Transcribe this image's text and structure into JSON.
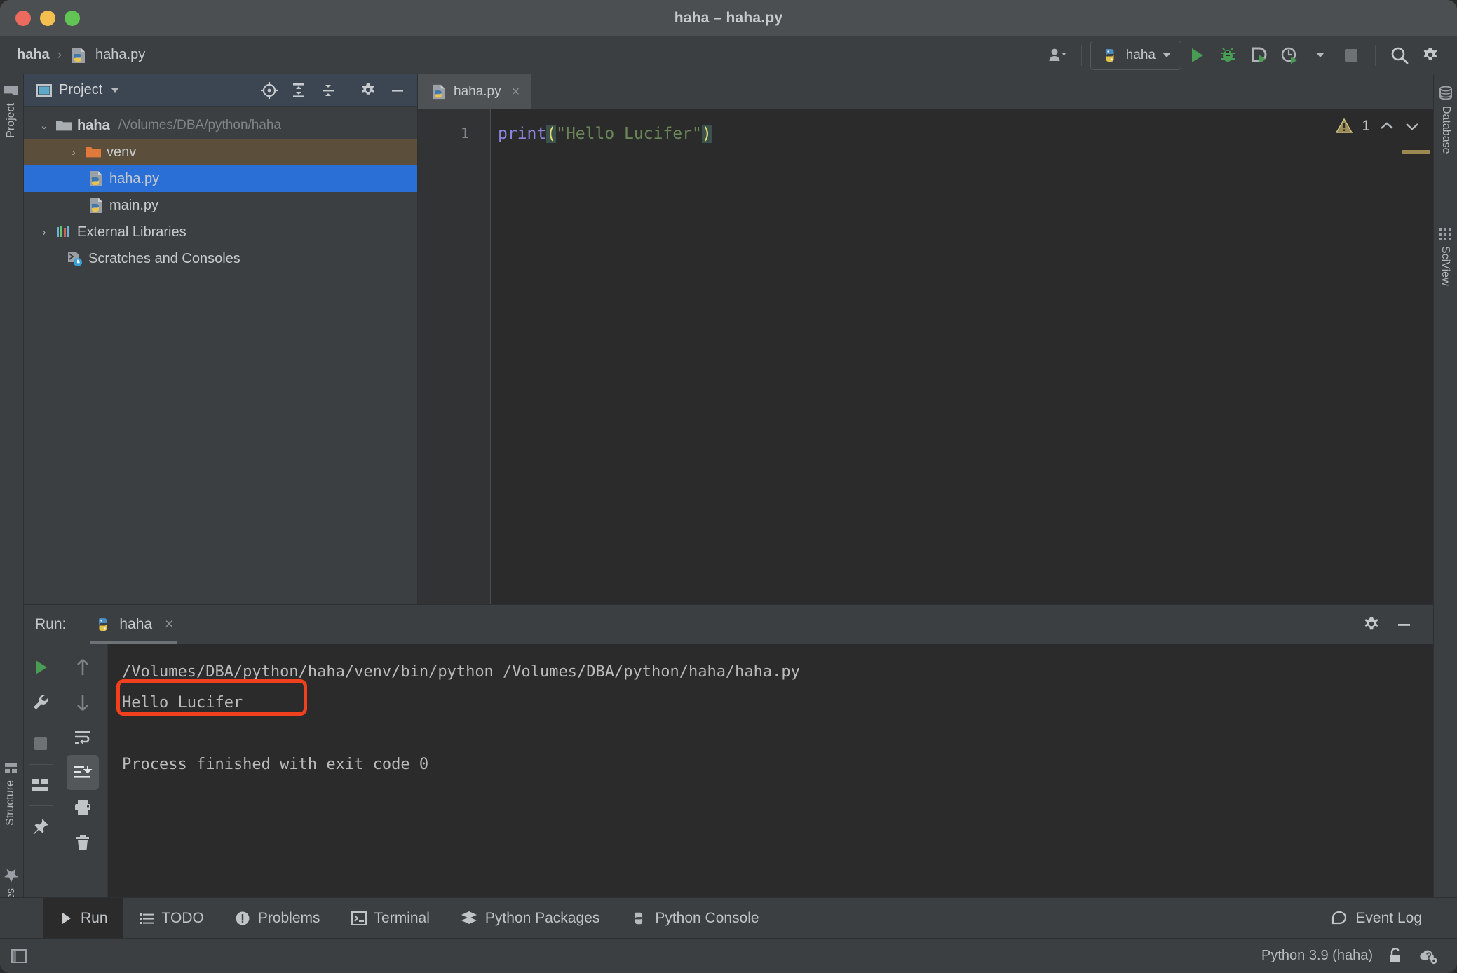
{
  "window": {
    "title": "haha – haha.py",
    "traffic_lights": [
      "close-red",
      "minimize-yellow",
      "zoom-green"
    ]
  },
  "toolbar": {
    "breadcrumb": {
      "project": "haha",
      "separator": "›",
      "file": "haha.py"
    },
    "icons": {
      "account": "account-icon",
      "run": "run-icon",
      "debug": "debug-icon",
      "coverage": "coverage-icon",
      "profile": "profile-icon",
      "stop": "stop-icon",
      "search": "search-icon",
      "settings": "settings-gear-icon"
    },
    "run_config": {
      "label": "haha",
      "icon": "python-icon"
    }
  },
  "rails": {
    "left": [
      {
        "label": "Project",
        "icon": "folder-icon"
      },
      {
        "label": "Structure",
        "icon": "structure-icon"
      },
      {
        "label": "Favorites",
        "icon": "star-icon"
      }
    ],
    "right": [
      {
        "label": "Database",
        "icon": "database-icon"
      },
      {
        "label": "SciView",
        "icon": "grid-icon"
      }
    ]
  },
  "project_panel": {
    "title": "Project",
    "tools": [
      "locate-icon",
      "expand-all-icon",
      "collapse-all-icon",
      "settings-gear-icon",
      "hide-icon"
    ],
    "tree": [
      {
        "label": "haha",
        "path": "/Volumes/DBA/python/haha",
        "icon": "folder-icon",
        "arrow": "⌄",
        "state": "expanded",
        "indent": 1,
        "bold": true
      },
      {
        "label": "venv",
        "path": "",
        "icon": "folder-orange-icon",
        "arrow": "›",
        "state": "hover",
        "indent": 2,
        "bold": false
      },
      {
        "label": "haha.py",
        "path": "",
        "icon": "python-file-icon",
        "arrow": "",
        "state": "selected",
        "indent": 3,
        "bold": false
      },
      {
        "label": "main.py",
        "path": "",
        "icon": "python-file-icon",
        "arrow": "",
        "state": "",
        "indent": 3,
        "bold": false
      },
      {
        "label": "External Libraries",
        "path": "",
        "icon": "libraries-icon",
        "arrow": "›",
        "state": "",
        "indent": 1,
        "bold": false
      },
      {
        "label": "Scratches and Consoles",
        "path": "",
        "icon": "scratches-icon",
        "arrow": "",
        "state": "",
        "indent": 2,
        "bold": false
      }
    ]
  },
  "editor": {
    "tab": {
      "label": "haha.py",
      "icon": "python-file-icon",
      "close": "×"
    },
    "line_number": "1",
    "code": {
      "func": "print",
      "open_paren": "(",
      "string": "\"Hello Lucifer\"",
      "close_paren": ")"
    },
    "inspections": {
      "count": "1",
      "icon": "warning-triangle-icon",
      "prev": "⌃",
      "next": "⌄"
    }
  },
  "run_panel": {
    "label": "Run:",
    "tab": {
      "label": "haha",
      "icon": "python-icon",
      "close": "×"
    },
    "header_tools": [
      "settings-gear-icon",
      "hide-icon"
    ],
    "left_tools": [
      "rerun-icon",
      "wrench-icon",
      "stop-icon",
      "layout-icon",
      "pin-icon"
    ],
    "right_tools": [
      "up-arrow-icon",
      "down-arrow-icon",
      "soft-wrap-icon",
      "scroll-to-end-icon",
      "print-icon",
      "trash-icon"
    ],
    "console_lines": [
      "/Volumes/DBA/python/haha/venv/bin/python /Volumes/DBA/python/haha/haha.py",
      "Hello Lucifer",
      "",
      "Process finished with exit code 0"
    ],
    "highlight": {
      "text": "Hello Lucifer",
      "color": "#f0401e"
    }
  },
  "bottom_bar": {
    "items": [
      {
        "label": "Run",
        "icon": "run-icon",
        "active": true
      },
      {
        "label": "TODO",
        "icon": "todo-icon",
        "active": false
      },
      {
        "label": "Problems",
        "icon": "problems-icon",
        "active": false
      },
      {
        "label": "Terminal",
        "icon": "terminal-icon",
        "active": false
      },
      {
        "label": "Python Packages",
        "icon": "packages-icon",
        "active": false
      },
      {
        "label": "Python Console",
        "icon": "python-icon",
        "active": false
      }
    ],
    "event_log": {
      "label": "Event Log",
      "icon": "event-log-icon"
    }
  },
  "status_bar": {
    "layout_icon": "window-layout-icon",
    "interpreter": "Python 3.9 (haha)",
    "icons": [
      "unlock-icon",
      "help-cloud-icon"
    ]
  },
  "colors": {
    "accent_selected": "#2a6fd6",
    "hover": "#5b4f3c",
    "panel_bg": "#3c3f41",
    "editor_bg": "#2b2b2b",
    "annotation": "#f0401e",
    "keyword": "#8a86dd",
    "string": "#6a8759"
  }
}
